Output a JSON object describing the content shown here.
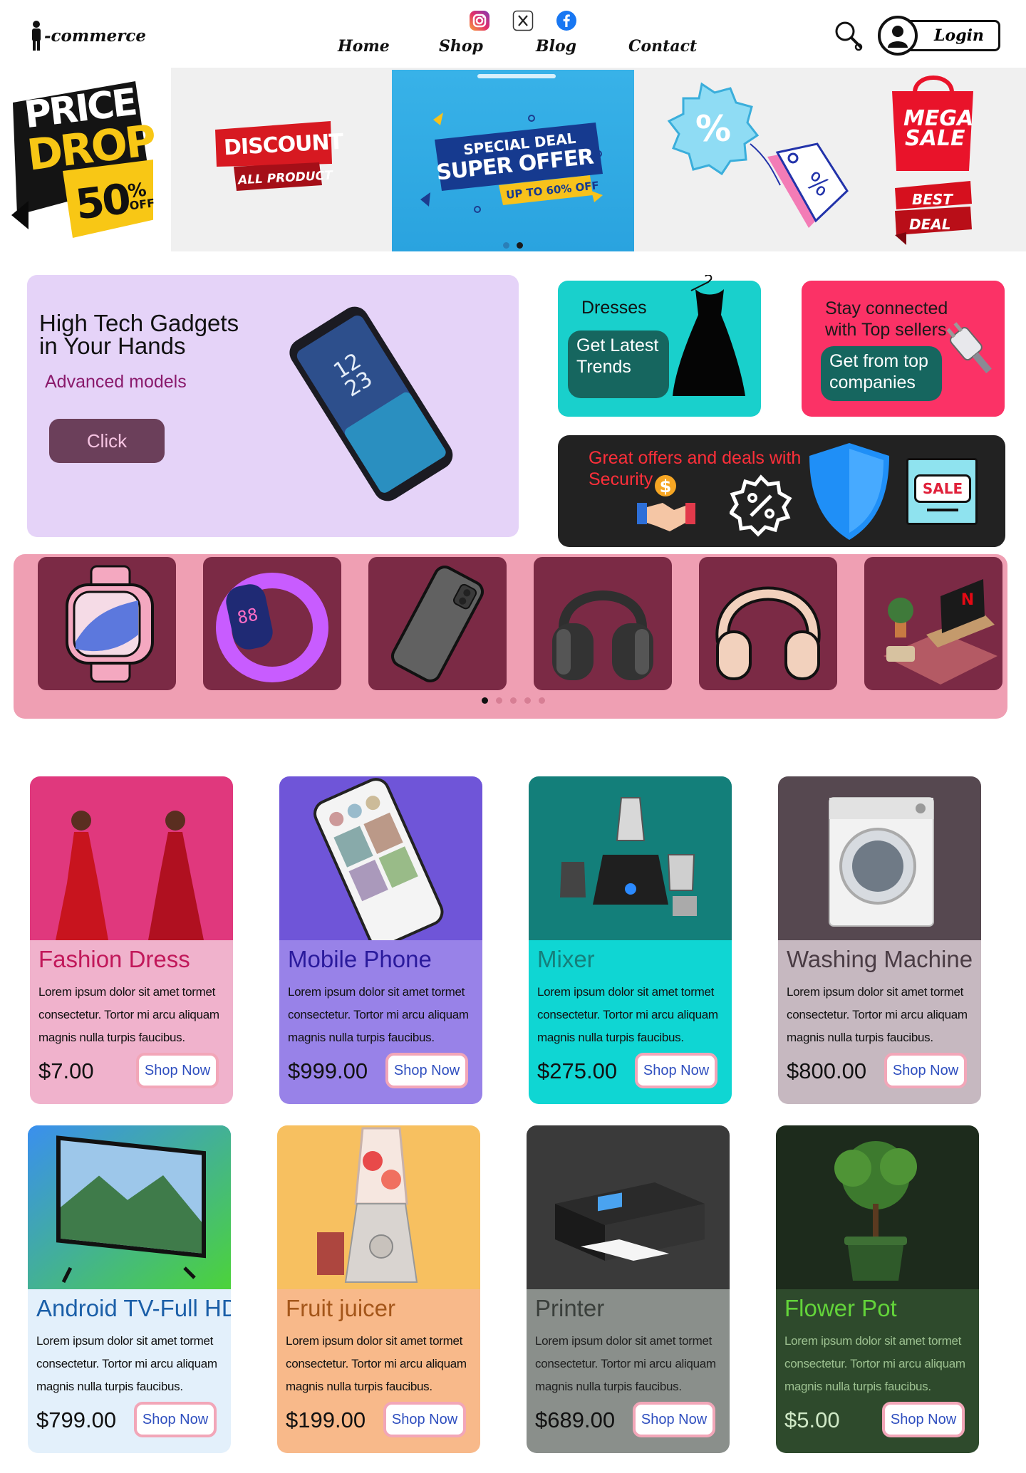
{
  "brand": {
    "logo_text": "-commerce"
  },
  "header": {
    "social_icons": [
      "instagram-icon",
      "x-icon",
      "facebook-icon"
    ],
    "nav": [
      "Home",
      "Shop",
      "Blog",
      "Contact"
    ],
    "login_label": "Login"
  },
  "banner": {
    "price_drop": {
      "line1": "PRICE",
      "line2": "DROP",
      "percent": "50",
      "unit": "%",
      "off": "OFF"
    },
    "discount": {
      "title": "DISCOUNT",
      "sub": "ALL PRODUCT"
    },
    "super_offer": {
      "line1": "SPECIAL DEAL",
      "line2": "SUPER OFFER",
      "line3": "UP TO 60% OFF"
    },
    "mega_sale": {
      "line1": "MEGA",
      "line2": "SALE",
      "line3": "BEST",
      "line4": "DEAL"
    },
    "active_slide": 1,
    "slide_count": 2
  },
  "promo": {
    "gadgets": {
      "title": "High Tech Gadgets in Your Hands",
      "subtitle": "Advanced models",
      "button": "Click"
    },
    "dresses": {
      "title": "Dresses",
      "pill": "Get Latest Trends"
    },
    "sellers": {
      "title": "Stay connected with Top sellers",
      "pill": "Get from top companies"
    },
    "security": {
      "title": "Great offers and deals with Security",
      "sale_tag": "SALE"
    }
  },
  "categories": {
    "items": [
      "smartwatch-icon",
      "fitness-band-icon",
      "smartphone-icon",
      "over-ear-headphones-icon",
      "headphones-icon",
      "living-room-tv-icon"
    ],
    "active_dot": 0,
    "dot_count": 5
  },
  "products": [
    {
      "name": "Fashion Dress",
      "desc": "Lorem ipsum dolor sit amet  tormet consectetur. Tortor mi arcu aliquam magnis nulla turpis faucibus.",
      "price": "$7.00",
      "cta": "Shop Now",
      "image": "fashion-dress-image",
      "colors": {
        "top": "#e0387d",
        "body": "#f0b2cc",
        "name": "#c1185a"
      }
    },
    {
      "name": "Mobile Phone",
      "desc": "Lorem ipsum dolor sit amet  tormet consectetur. Tortor mi arcu aliquam magnis nulla turpis faucibus.",
      "price": "$999.00",
      "cta": "Shop Now",
      "image": "mobile-phone-image",
      "colors": {
        "top": "#6f55d8",
        "body": "#9882e8",
        "name": "#2a1a9c"
      }
    },
    {
      "name": "Mixer",
      "desc": "Lorem ipsum dolor sit amet  tormet consectetur. Tortor mi arcu aliquam magnis nulla turpis faucibus.",
      "price": "$275.00",
      "cta": "Shop Now",
      "image": "mixer-image",
      "colors": {
        "top": "#137f7a",
        "body": "#0fd6d3",
        "name": "#157f7b"
      }
    },
    {
      "name": "Washing Machine",
      "desc": "Lorem ipsum dolor sit amet  tormet consectetur. Tortor mi arcu aliquam magnis nulla turpis faucibus.",
      "price": "$800.00",
      "cta": "Shop Now",
      "image": "washing-machine-image",
      "colors": {
        "top": "#564850",
        "body": "#c6b8c0",
        "name": "#4a3c44"
      }
    },
    {
      "name": "Android TV-Full HD",
      "desc": "Lorem ipsum dolor sit amet  tormet consectetur. Tortor mi arcu aliquam magnis nulla turpis faucibus.",
      "price": "$799.00",
      "cta": "Shop Now",
      "image": "android-tv-image",
      "colors": {
        "top": "#3aa0e8",
        "body": "#e3f0fb",
        "name": "#1b5fa8"
      }
    },
    {
      "name": "Fruit juicer",
      "desc": "Lorem ipsum dolor sit amet  tormet consectetur. Tortor mi arcu aliquam magnis nulla turpis faucibus.",
      "price": "$199.00",
      "cta": "Shop Now",
      "image": "fruit-juicer-image",
      "colors": {
        "top": "#f7c060",
        "body": "#f8b98a",
        "name": "#a4561a"
      }
    },
    {
      "name": "Printer",
      "desc": "Lorem ipsum dolor sit amet  tormet consectetur. Tortor mi arcu aliquam magnis nulla turpis faucibus.",
      "price": "$689.00",
      "cta": "Shop Now",
      "image": "printer-image",
      "colors": {
        "top": "#3a3a3a",
        "body": "#8a8f8b",
        "name": "#3a3f3b"
      }
    },
    {
      "name": "Flower Pot",
      "desc": "Lorem ipsum dolor sit amet  tormet consectetur. Tortor mi arcu aliquam magnis nulla turpis faucibus.",
      "price": "$5.00",
      "cta": "Shop Now",
      "image": "flower-pot-image",
      "colors": {
        "top": "#1d2b1c",
        "body": "#2e4a2c",
        "name": "#63d43a"
      }
    }
  ]
}
